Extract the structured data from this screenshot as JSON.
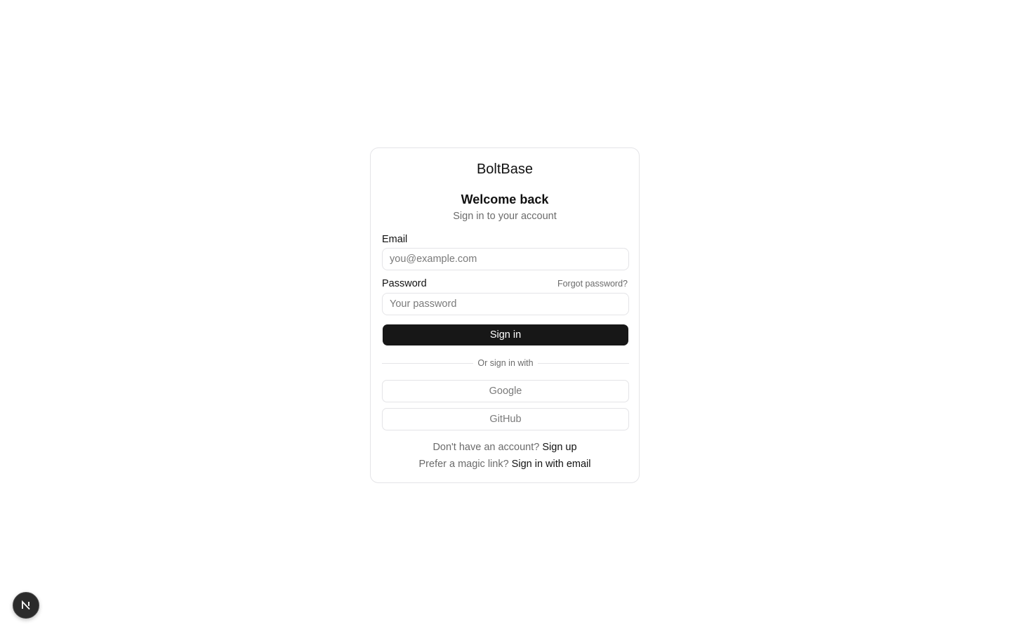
{
  "brand": "BoltBase",
  "header": {
    "title": "Welcome back",
    "subtitle": "Sign in to your account"
  },
  "form": {
    "email_label": "Email",
    "email_placeholder": "you@example.com",
    "email_value": "",
    "password_label": "Password",
    "password_placeholder": "Your password",
    "password_value": "",
    "forgot_label": "Forgot password?",
    "submit_label": "Sign in"
  },
  "divider_text": "Or sign in with",
  "oauth": {
    "google_label": "Google",
    "github_label": "GitHub"
  },
  "footer": {
    "signup_prompt": "Don't have an account?",
    "signup_link": "Sign up",
    "magic_prompt": "Prefer a magic link?",
    "magic_link": "Sign in with email"
  },
  "dev_badge": {
    "icon": "nextjs-logo-icon",
    "letter": "N"
  },
  "colors": {
    "primary_button": "#171717",
    "border": "#e4e4e7",
    "muted_text": "#6b6b6b"
  }
}
